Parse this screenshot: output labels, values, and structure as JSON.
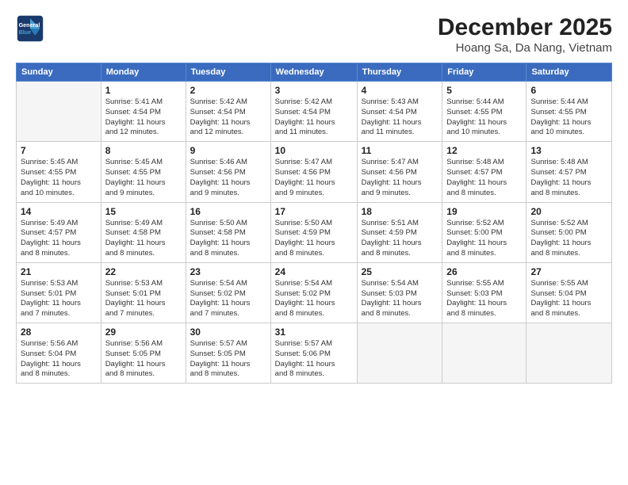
{
  "header": {
    "logo_line1": "General",
    "logo_line2": "Blue",
    "title": "December 2025",
    "subtitle": "Hoang Sa, Da Nang, Vietnam"
  },
  "calendar": {
    "headers": [
      "Sunday",
      "Monday",
      "Tuesday",
      "Wednesday",
      "Thursday",
      "Friday",
      "Saturday"
    ],
    "weeks": [
      [
        {
          "day": "",
          "info": ""
        },
        {
          "day": "1",
          "info": "Sunrise: 5:41 AM\nSunset: 4:54 PM\nDaylight: 11 hours\nand 12 minutes."
        },
        {
          "day": "2",
          "info": "Sunrise: 5:42 AM\nSunset: 4:54 PM\nDaylight: 11 hours\nand 12 minutes."
        },
        {
          "day": "3",
          "info": "Sunrise: 5:42 AM\nSunset: 4:54 PM\nDaylight: 11 hours\nand 11 minutes."
        },
        {
          "day": "4",
          "info": "Sunrise: 5:43 AM\nSunset: 4:54 PM\nDaylight: 11 hours\nand 11 minutes."
        },
        {
          "day": "5",
          "info": "Sunrise: 5:44 AM\nSunset: 4:55 PM\nDaylight: 11 hours\nand 10 minutes."
        },
        {
          "day": "6",
          "info": "Sunrise: 5:44 AM\nSunset: 4:55 PM\nDaylight: 11 hours\nand 10 minutes."
        }
      ],
      [
        {
          "day": "7",
          "info": "Sunrise: 5:45 AM\nSunset: 4:55 PM\nDaylight: 11 hours\nand 10 minutes."
        },
        {
          "day": "8",
          "info": "Sunrise: 5:45 AM\nSunset: 4:55 PM\nDaylight: 11 hours\nand 9 minutes."
        },
        {
          "day": "9",
          "info": "Sunrise: 5:46 AM\nSunset: 4:56 PM\nDaylight: 11 hours\nand 9 minutes."
        },
        {
          "day": "10",
          "info": "Sunrise: 5:47 AM\nSunset: 4:56 PM\nDaylight: 11 hours\nand 9 minutes."
        },
        {
          "day": "11",
          "info": "Sunrise: 5:47 AM\nSunset: 4:56 PM\nDaylight: 11 hours\nand 9 minutes."
        },
        {
          "day": "12",
          "info": "Sunrise: 5:48 AM\nSunset: 4:57 PM\nDaylight: 11 hours\nand 8 minutes."
        },
        {
          "day": "13",
          "info": "Sunrise: 5:48 AM\nSunset: 4:57 PM\nDaylight: 11 hours\nand 8 minutes."
        }
      ],
      [
        {
          "day": "14",
          "info": "Sunrise: 5:49 AM\nSunset: 4:57 PM\nDaylight: 11 hours\nand 8 minutes."
        },
        {
          "day": "15",
          "info": "Sunrise: 5:49 AM\nSunset: 4:58 PM\nDaylight: 11 hours\nand 8 minutes."
        },
        {
          "day": "16",
          "info": "Sunrise: 5:50 AM\nSunset: 4:58 PM\nDaylight: 11 hours\nand 8 minutes."
        },
        {
          "day": "17",
          "info": "Sunrise: 5:50 AM\nSunset: 4:59 PM\nDaylight: 11 hours\nand 8 minutes."
        },
        {
          "day": "18",
          "info": "Sunrise: 5:51 AM\nSunset: 4:59 PM\nDaylight: 11 hours\nand 8 minutes."
        },
        {
          "day": "19",
          "info": "Sunrise: 5:52 AM\nSunset: 5:00 PM\nDaylight: 11 hours\nand 8 minutes."
        },
        {
          "day": "20",
          "info": "Sunrise: 5:52 AM\nSunset: 5:00 PM\nDaylight: 11 hours\nand 8 minutes."
        }
      ],
      [
        {
          "day": "21",
          "info": "Sunrise: 5:53 AM\nSunset: 5:01 PM\nDaylight: 11 hours\nand 7 minutes."
        },
        {
          "day": "22",
          "info": "Sunrise: 5:53 AM\nSunset: 5:01 PM\nDaylight: 11 hours\nand 7 minutes."
        },
        {
          "day": "23",
          "info": "Sunrise: 5:54 AM\nSunset: 5:02 PM\nDaylight: 11 hours\nand 7 minutes."
        },
        {
          "day": "24",
          "info": "Sunrise: 5:54 AM\nSunset: 5:02 PM\nDaylight: 11 hours\nand 8 minutes."
        },
        {
          "day": "25",
          "info": "Sunrise: 5:54 AM\nSunset: 5:03 PM\nDaylight: 11 hours\nand 8 minutes."
        },
        {
          "day": "26",
          "info": "Sunrise: 5:55 AM\nSunset: 5:03 PM\nDaylight: 11 hours\nand 8 minutes."
        },
        {
          "day": "27",
          "info": "Sunrise: 5:55 AM\nSunset: 5:04 PM\nDaylight: 11 hours\nand 8 minutes."
        }
      ],
      [
        {
          "day": "28",
          "info": "Sunrise: 5:56 AM\nSunset: 5:04 PM\nDaylight: 11 hours\nand 8 minutes."
        },
        {
          "day": "29",
          "info": "Sunrise: 5:56 AM\nSunset: 5:05 PM\nDaylight: 11 hours\nand 8 minutes."
        },
        {
          "day": "30",
          "info": "Sunrise: 5:57 AM\nSunset: 5:05 PM\nDaylight: 11 hours\nand 8 minutes."
        },
        {
          "day": "31",
          "info": "Sunrise: 5:57 AM\nSunset: 5:06 PM\nDaylight: 11 hours\nand 8 minutes."
        },
        {
          "day": "",
          "info": ""
        },
        {
          "day": "",
          "info": ""
        },
        {
          "day": "",
          "info": ""
        }
      ]
    ]
  }
}
